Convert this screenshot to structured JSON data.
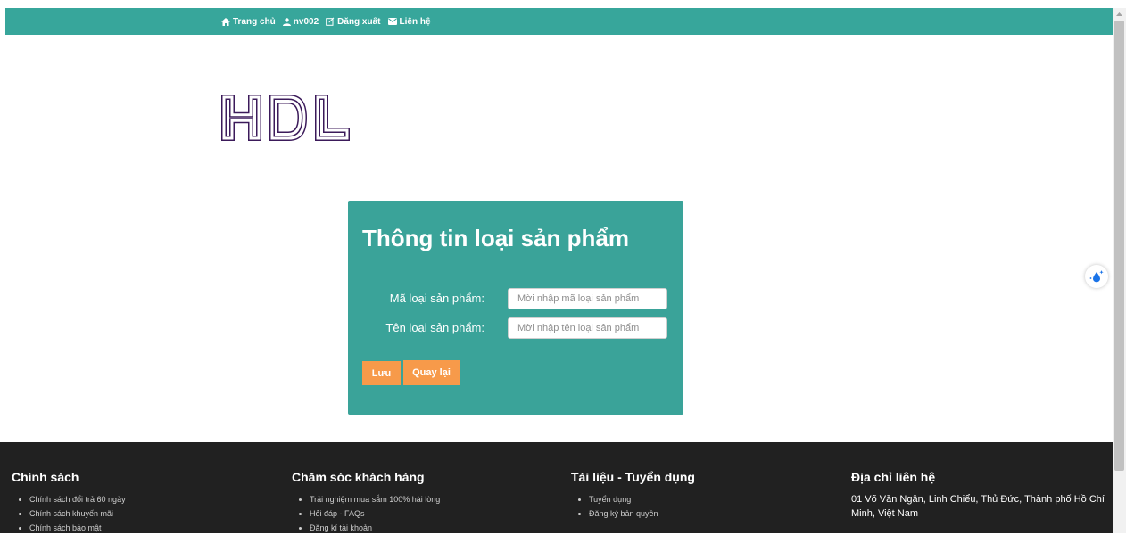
{
  "nav": {
    "home": "Trang chủ",
    "user": "nv002",
    "logout": "Đăng xuất",
    "contact": "Liên hệ"
  },
  "logo": {
    "text": "HDL",
    "color": "#3b1a5a"
  },
  "form": {
    "title": "Thông tin loại sản phẩm",
    "code_label": "Mã loại sản phẩm:",
    "code_placeholder": "Mời nhập mã loại sản phẩm",
    "name_label": "Tên loại sản phẩm:",
    "name_placeholder": "Mời nhập tên loại sản phẩm",
    "save": "Lưu",
    "back": "Quay lại"
  },
  "footer": {
    "policy": {
      "title": "Chính sách",
      "items": [
        "Chính sách đổi trả 60 ngày",
        "Chính sách khuyến mãi",
        "Chính sách bảo mật"
      ]
    },
    "care": {
      "title": "Chăm sóc khách hàng",
      "items": [
        "Trải nghiệm mua sắm 100% hài lòng",
        "Hỏi đáp - FAQs",
        "Đăng kí tài khoản"
      ]
    },
    "docs": {
      "title": "Tài liệu - Tuyển dụng",
      "items": [
        "Tuyển dụng",
        "Đăng ký bản quyền"
      ]
    },
    "address": {
      "title": "Địa chỉ liên hệ",
      "text": "01 Võ Văn Ngân, Linh Chiểu, Thủ Đức, Thành phố Hồ Chí Minh, Việt Nam"
    }
  },
  "colors": {
    "topbar": "#37a69b",
    "card": "#3aa399",
    "button": "#f79a4a",
    "footer": "#212121"
  },
  "icons": {
    "home": "home-icon",
    "user": "user-icon",
    "logout": "edit-icon",
    "contact": "envelope-icon",
    "widget": "water-drop-icon"
  }
}
